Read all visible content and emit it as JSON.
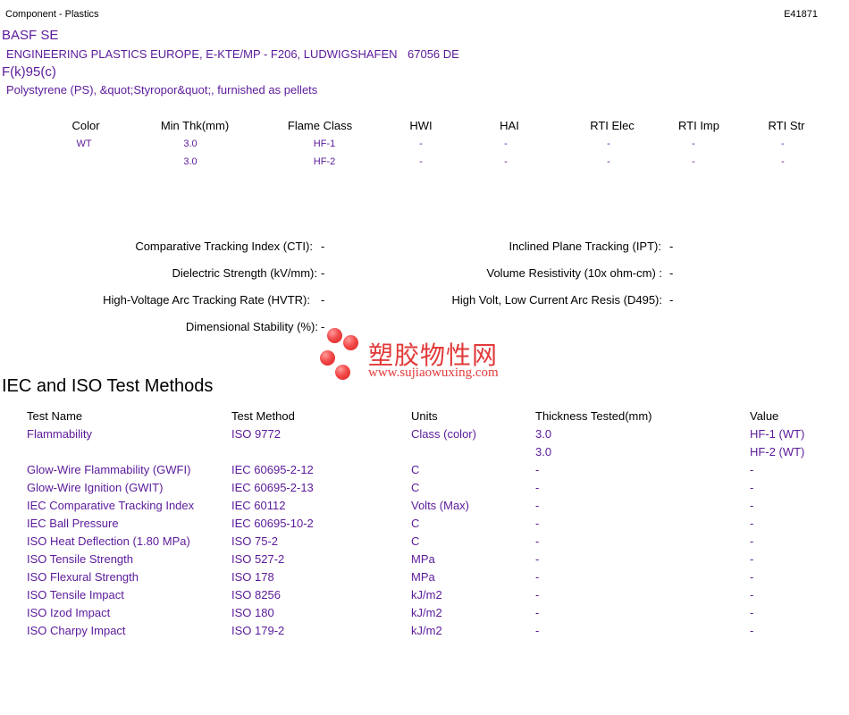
{
  "header": {
    "left": "Component - Plastics",
    "right": "E41871"
  },
  "company": {
    "name": "BASF SE",
    "address": "ENGINEERING PLASTICS EUROPE, E-KTE/MP - F206, LUDWIGSHAFEN",
    "postal": "67056 DE",
    "grade": "F(k)95(c)",
    "description": "Polystyrene (PS), &quot;Styropor&quot;, furnished as pellets"
  },
  "rating_table": {
    "columns": [
      "Color",
      "Min Thk(mm)",
      "Flame Class",
      "HWI",
      "HAI",
      "RTI Elec",
      "RTI Imp",
      "RTI Str"
    ],
    "rows": [
      [
        "WT",
        "3.0",
        "HF-1",
        "-",
        "-",
        "-",
        "-",
        "-"
      ],
      [
        "",
        "3.0",
        "HF-2",
        "-",
        "-",
        "-",
        "-",
        "-"
      ]
    ]
  },
  "properties": {
    "left": [
      {
        "label": "Comparative Tracking Index (CTI):",
        "value": "-"
      },
      {
        "label": "Dielectric Strength (kV/mm):",
        "value": "-"
      },
      {
        "label": "High-Voltage Arc Tracking Rate (HVTR):",
        "value": "-"
      },
      {
        "label": "Dimensional Stability (%):",
        "value": "-"
      }
    ],
    "right": [
      {
        "label": "Inclined Plane Tracking (IPT):",
        "value": "-"
      },
      {
        "label": "Volume Resistivity (10x ohm-cm) :",
        "value": "-"
      },
      {
        "label": "High Volt, Low Current Arc Resis (D495):",
        "value": "-"
      }
    ]
  },
  "watermark": {
    "chinese": "塑胶物性网",
    "url": "www.sujiaowuxing.com"
  },
  "test_methods": {
    "title": "IEC and ISO Test Methods",
    "columns": [
      "Test Name",
      "Test Method",
      "Units",
      "Thickness Tested(mm)",
      "Value"
    ],
    "rows": [
      [
        "Flammability",
        "ISO 9772",
        "Class (color)",
        "3.0",
        "HF-1 (WT)"
      ],
      [
        "",
        "",
        "",
        "3.0",
        "HF-2 (WT)"
      ],
      [
        "Glow-Wire Flammability (GWFI)",
        "IEC 60695-2-12",
        "C",
        "-",
        "-"
      ],
      [
        "Glow-Wire Ignition (GWIT)",
        "IEC 60695-2-13",
        "C",
        "-",
        "-"
      ],
      [
        "IEC Comparative Tracking Index",
        "IEC 60112",
        "Volts (Max)",
        "-",
        "-"
      ],
      [
        "IEC Ball Pressure",
        "IEC 60695-10-2",
        "C",
        "-",
        "-"
      ],
      [
        "ISO Heat Deflection (1.80 MPa)",
        "ISO 75-2",
        "C",
        "-",
        "-"
      ],
      [
        "ISO Tensile Strength",
        "ISO 527-2",
        "MPa",
        "-",
        "-"
      ],
      [
        "ISO Flexural Strength",
        "ISO 178",
        "MPa",
        "-",
        "-"
      ],
      [
        "ISO Tensile Impact",
        "ISO 8256",
        "kJ/m2",
        "-",
        "-"
      ],
      [
        "ISO Izod Impact",
        "ISO 180",
        "kJ/m2",
        "-",
        "-"
      ],
      [
        "ISO Charpy Impact",
        "ISO 179-2",
        "kJ/m2",
        "-",
        "-"
      ]
    ]
  }
}
